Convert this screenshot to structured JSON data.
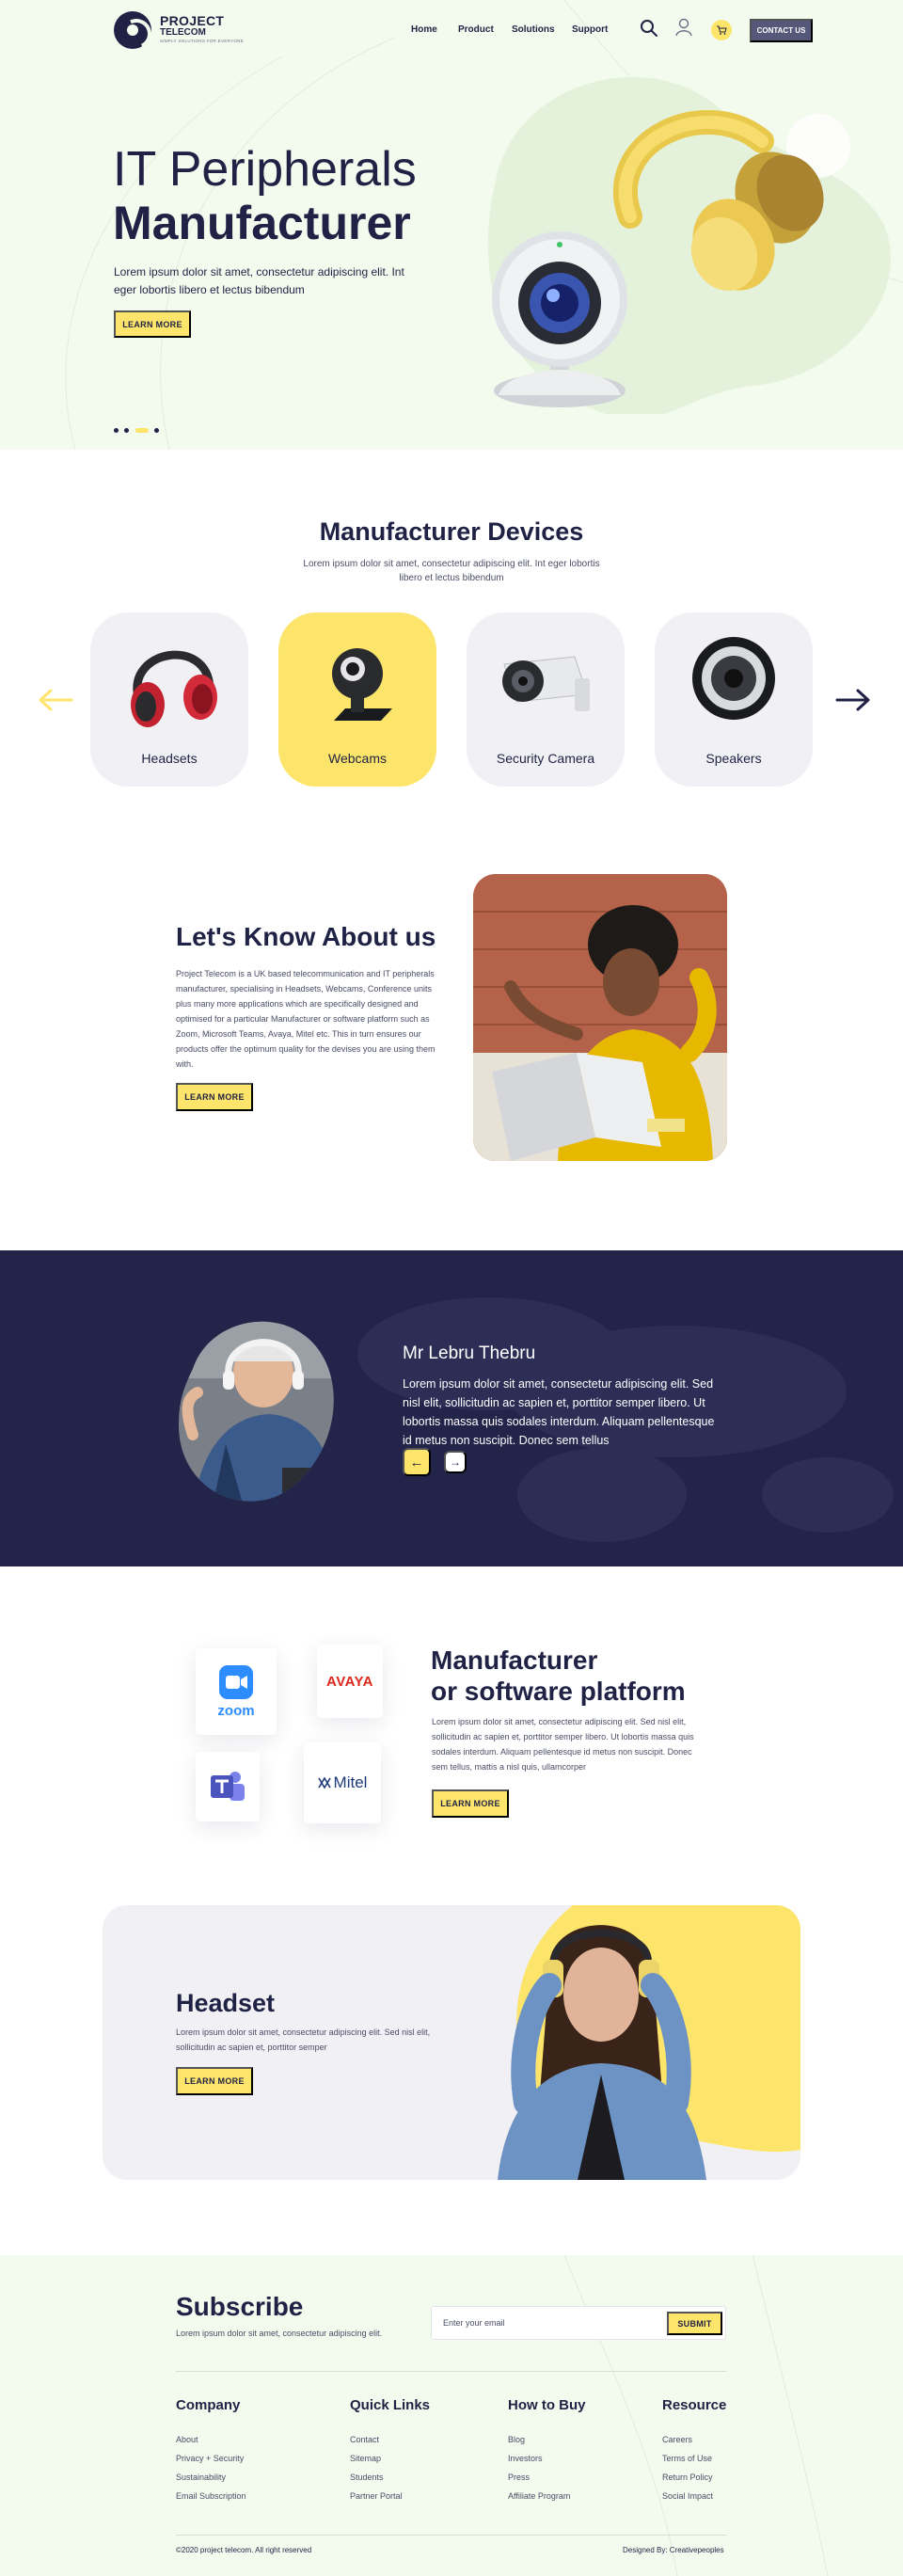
{
  "header": {
    "logo_line1": "PROJECT",
    "logo_line2": "TELECOM",
    "logo_tagline": "SIMPLY SOLUTIONS FOR EVERYONE",
    "nav": [
      "Home",
      "Product",
      "Solutions",
      "Support"
    ],
    "contact_label": "CONTACT US"
  },
  "hero": {
    "title_line1": "IT Peripherals",
    "title_line2": "Manufacturer",
    "text": "Lorem ipsum dolor sit amet, consectetur adipiscing elit. Int eger lobortis libero et lectus bibendum",
    "button": "LEARN MORE"
  },
  "devices": {
    "title": "Manufacturer Devices",
    "subtitle_line1": "Lorem ipsum dolor sit amet, consectetur adipiscing elit. Int eger lobortis",
    "subtitle_line2": "libero et lectus bibendum",
    "items": [
      {
        "label": "Headsets",
        "icon": "headphones-icon"
      },
      {
        "label": "Webcams",
        "icon": "webcam-icon"
      },
      {
        "label": "Security Camera",
        "icon": "security-camera-icon"
      },
      {
        "label": "Speakers",
        "icon": "speaker-icon"
      }
    ],
    "active_index": 1
  },
  "about": {
    "title": "Let's Know About us",
    "text": "Project Telecom is a UK based telecommunication and IT peripherals manufacturer, specialising in Headsets, Webcams, Conference units plus many more applications which are specifically designed and optimised for a particular Manufacturer or software platform such as Zoom, Microsoft Teams, Avaya, Mitel etc. This in turn ensures our products offer the optimum quality for the devises you are using them with.",
    "button": "LEARN MORE"
  },
  "testimonial": {
    "name": "Mr Lebru Thebru",
    "quote": "Lorem ipsum dolor sit amet, consectetur adipiscing elit. Sed nisl elit, sollicitudin ac sapien et, porttitor semper libero. Ut lobortis massa quis sodales interdum. Aliquam pellentesque id metus non suscipit. Donec sem tellus",
    "prev_label": "←",
    "next_label": "→"
  },
  "platform": {
    "title_line1": "Manufacturer",
    "title_line2": "or software platform",
    "text": "Lorem ipsum dolor sit amet, consectetur adipiscing elit. Sed nisl elit, sollicitudin ac sapien et, porttitor semper libero. Ut lobortis massa quis sodales interdum. Aliquam pellentesque id metus non suscipit. Donec sem tellus, mattis a nisl quis, ullamcorper",
    "button": "LEARN MORE",
    "logos": {
      "zoom": "zoom",
      "avaya": "AVAYA",
      "mitel": "Mitel"
    }
  },
  "headset": {
    "title": "Headset",
    "text": "Lorem ipsum dolor sit amet, consectetur adipiscing elit. Sed nisl elit, sollicitudin ac sapien et, porttitor semper",
    "button": "LEARN MORE"
  },
  "subscribe": {
    "title": "Subscribe",
    "text": "Lorem ipsum dolor sit amet, consectetur adipiscing elit.",
    "placeholder": "Enter your email",
    "button": "SUBMIT"
  },
  "footer": {
    "columns": [
      {
        "title": "Company",
        "links": [
          "About",
          "Privacy + Security",
          "Sustainability",
          "Email Subscription"
        ]
      },
      {
        "title": "Quick Links",
        "links": [
          "Contact",
          "Sitemap",
          "Students",
          "Partner Portal"
        ]
      },
      {
        "title": "How to Buy",
        "links": [
          "Blog",
          "Investors",
          "Press",
          "Affiliate Program"
        ]
      },
      {
        "title": "Resource",
        "links": [
          "Careers",
          "Terms of Use",
          "Return Policy",
          "Social Impact"
        ]
      }
    ],
    "copyright": "©2020 project telecom. All right reserved",
    "designed_by": "Designed By: Creativepeoples"
  },
  "colors": {
    "navy": "#1f2244",
    "yellow": "#fde56b",
    "mint": "#f3faee",
    "card": "#f1f0f5"
  }
}
